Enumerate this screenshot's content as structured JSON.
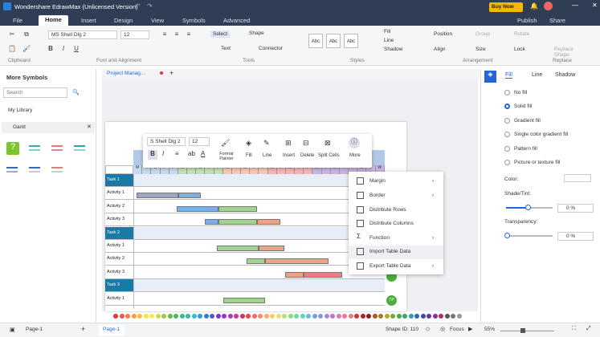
{
  "app": {
    "title": "Wondershare EdrawMax (Unlicensed Version)",
    "buy": "Buy Now",
    "publish": "Publish",
    "share": "Share"
  },
  "menus": [
    "File",
    "Home",
    "Insert",
    "Design",
    "View",
    "Symbols",
    "Advanced"
  ],
  "ribbon": {
    "font": "MS Shell Dlg 2",
    "size": "12",
    "select": "Select",
    "shape": "Shape",
    "text": "Text",
    "connector": "Connector",
    "fill": "Fill",
    "line": "Line",
    "shadow": "Shadow",
    "position": "Position",
    "group": "Group",
    "rotate": "Rotate",
    "align": "Align",
    "size_label": "Size",
    "lock": "Lock",
    "replace_shape": "Replace Shape",
    "style_abc": "Abc",
    "groups": {
      "clipboard": "Clipboard",
      "font": "Font and Alignment",
      "tools": "Tools",
      "styles": "Styles",
      "arrangement": "Arrangement",
      "replace": "Replace"
    }
  },
  "left": {
    "title": "More Symbols",
    "search_placeholder": "Search",
    "library": "My Library",
    "gantt": "Gantt"
  },
  "doc": {
    "tab": "Project Manag...",
    "ruler": [
      "-50",
      "0",
      "50",
      "100",
      "150",
      "200",
      "250",
      "300",
      "350",
      "400",
      "450",
      "500",
      "550",
      "600"
    ]
  },
  "toolbar": {
    "font": "S Shell Dlg 2",
    "size": "12",
    "format_painter": "Format Painter",
    "fill": "Fill",
    "line": "Line",
    "insert": "Insert",
    "delete": "Delete",
    "split": "Split Cells",
    "more": "More",
    "bold": "B",
    "italic": "I"
  },
  "gantt": {
    "days": [
      "M",
      "T",
      "W",
      "T",
      "F",
      "M",
      "T",
      "W",
      "T",
      "F",
      "M",
      "T",
      "W",
      "T",
      "F",
      "M",
      "T",
      "W",
      "T",
      "F",
      "M",
      "T",
      "W",
      "T",
      "F",
      "M",
      "T",
      "W"
    ],
    "rows": [
      "Task 1",
      "Activity 1",
      "Activity 2",
      "Activity 3",
      "Task 2",
      "Activity 1",
      "Activity 2",
      "Activity 3",
      "Task 3",
      "Activity 1"
    ],
    "tp": "TP"
  },
  "context": [
    "Margin",
    "Border",
    "Distribute Rows",
    "Distribute Columns",
    "Function",
    "Import Table Data",
    "Export Table Data"
  ],
  "right": {
    "tabs": [
      "Fill",
      "Line",
      "Shadow"
    ],
    "options": [
      "No fill",
      "Solid fill",
      "Gradient fill",
      "Single color gradient fill",
      "Pattern fill",
      "Picture or texture fill"
    ],
    "color": "Color:",
    "shade": "Shade/Tint:",
    "shade_val": "0 %",
    "transparency": "Transparency:",
    "trans_val": "0 %"
  },
  "status": {
    "page": "Page-1",
    "page_tab": "Page-1",
    "shape_id": "Shape ID: 110",
    "focus": "Focus",
    "zoom": "55%"
  }
}
